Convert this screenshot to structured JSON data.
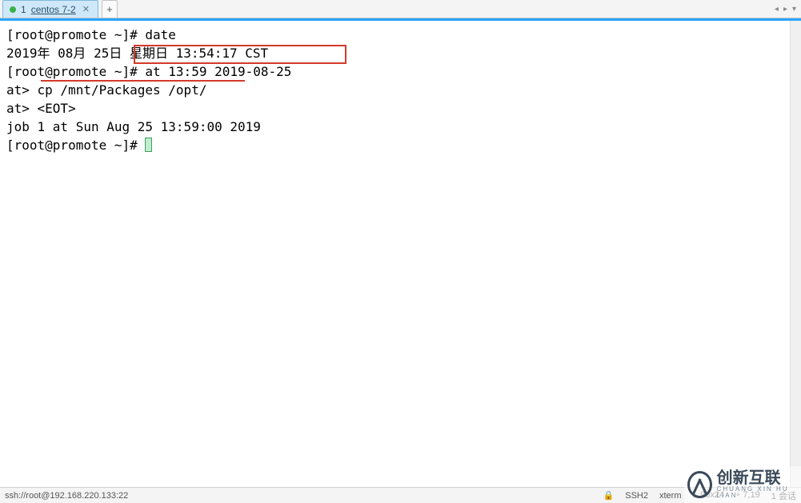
{
  "tab": {
    "index": "1",
    "title": "centos 7-2",
    "close_glyph": "✕"
  },
  "tabbar": {
    "new_tab_glyph": "+",
    "nav_left": "◂",
    "nav_right": "▸",
    "menu_glyph": "▾"
  },
  "terminal": {
    "lines": {
      "l1_prompt": "[root@promote ~]# ",
      "l1_cmd": "date",
      "l2": "2019年 08月 25日 星期日 13:54:17 CST",
      "l3_prompt": "[root@promote ~]# ",
      "l3_cmd": "at 13:59 2019-08-25",
      "l4": "at> cp /mnt/Packages /opt/",
      "l5": "at> <EOT>",
      "l6": "job 1 at Sun Aug 25 13:59:00 2019",
      "l7_prompt": "[root@promote ~]# "
    }
  },
  "status": {
    "conn": "ssh://root@192.168.220.133:22",
    "lock_glyph": "🔒",
    "proto": "SSH2",
    "term": "xterm",
    "size_glyph": "⟀",
    "size": "96x24",
    "pos_glyph": "⌖",
    "pos": "7,19",
    "sessions": "1 会话"
  },
  "watermark": {
    "cn": "创新互联",
    "en": "CHUANG XIN HU LIAN"
  }
}
